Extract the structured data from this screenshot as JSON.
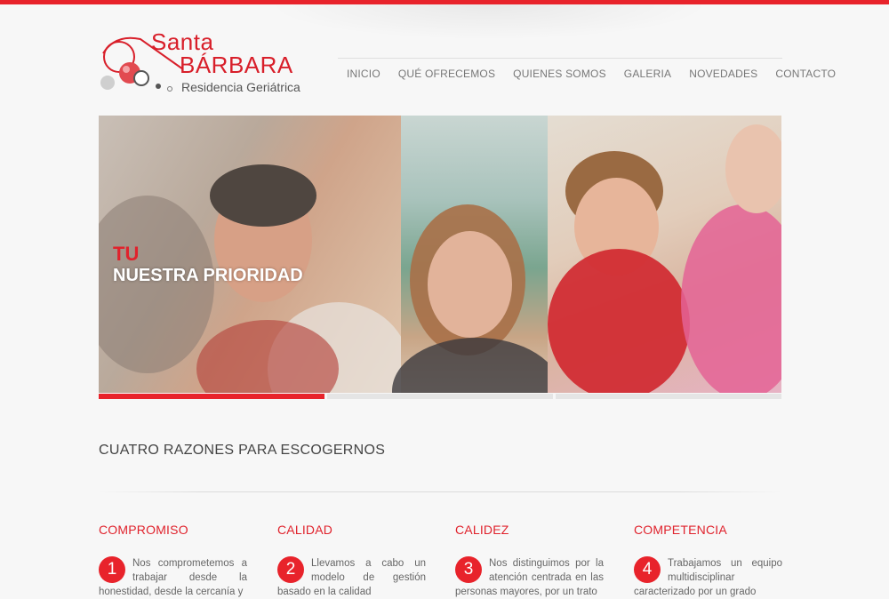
{
  "colors": {
    "accent": "#e8232b",
    "text": "#555555",
    "background": "#f7f7f7"
  },
  "logo": {
    "line1": "Santa",
    "line2": "BÁRBARA",
    "subtitle": "Residencia Geriátrica"
  },
  "nav": {
    "items": [
      {
        "label": "INICIO"
      },
      {
        "label": "QUÉ OFRECEMOS"
      },
      {
        "label": "QUIENES SOMOS"
      },
      {
        "label": "GALERIA"
      },
      {
        "label": "NOVEDADES"
      },
      {
        "label": "CONTACTO"
      }
    ]
  },
  "hero": {
    "line1": "TU",
    "line2": "NUESTRA PRIORIDAD",
    "slides_total": 3,
    "active_slide": 1
  },
  "section": {
    "title": "CUATRO RAZONES PARA ESCOGERNOS"
  },
  "reasons": [
    {
      "number": "1",
      "title": "COMPROMISO",
      "text": "Nos comprometemos a trabajar desde la honestidad, desde la cercanía y"
    },
    {
      "number": "2",
      "title": "CALIDAD",
      "text": "Llevamos a cabo un modelo de gestión basado en la calidad"
    },
    {
      "number": "3",
      "title": "CALIDEZ",
      "text": "Nos distinguimos por la atención centrada en las personas mayores, por un trato"
    },
    {
      "number": "4",
      "title": "COMPETENCIA",
      "text": "Trabajamos un equipo multidisciplinar caracterizado por un grado"
    }
  ]
}
